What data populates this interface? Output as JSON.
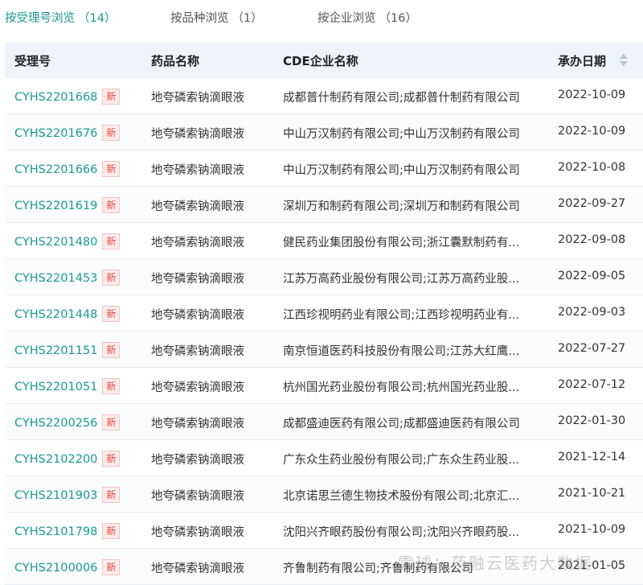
{
  "tabs": [
    {
      "label": "按受理号浏览",
      "count": "（14）",
      "active": true
    },
    {
      "label": "按品种浏览",
      "count": "（1）",
      "active": false
    },
    {
      "label": "按企业浏览",
      "count": "（16）",
      "active": false
    }
  ],
  "table": {
    "headers": {
      "id": "受理号",
      "drug": "药品名称",
      "company": "CDE企业名称",
      "date": "承办日期"
    },
    "badge_label": "新",
    "rows": [
      {
        "id": "CYHS2201668",
        "drug": "地夸磷索钠滴眼液",
        "company": "成都普什制药有限公司;成都普什制药有限公司",
        "date": "2022-10-09"
      },
      {
        "id": "CYHS2201676",
        "drug": "地夸磷索钠滴眼液",
        "company": "中山万汉制药有限公司;中山万汉制药有限公司",
        "date": "2022-10-09"
      },
      {
        "id": "CYHS2201666",
        "drug": "地夸磷索钠滴眼液",
        "company": "中山万汉制药有限公司;中山万汉制药有限公司",
        "date": "2022-10-08"
      },
      {
        "id": "CYHS2201619",
        "drug": "地夸磷索钠滴眼液",
        "company": "深圳万和制药有限公司;深圳万和制药有限公司",
        "date": "2022-09-27"
      },
      {
        "id": "CYHS2201480",
        "drug": "地夸磷索钠滴眼液",
        "company": "健民药业集团股份有限公司;浙江囊默制药有...",
        "date": "2022-09-08"
      },
      {
        "id": "CYHS2201453",
        "drug": "地夸磷索钠滴眼液",
        "company": "江苏万高药业股份有限公司;江苏万高药业股...",
        "date": "2022-09-05"
      },
      {
        "id": "CYHS2201448",
        "drug": "地夸磷索钠滴眼液",
        "company": "江西珍视明药业有限公司;江西珍视明药业有...",
        "date": "2022-09-03"
      },
      {
        "id": "CYHS2201151",
        "drug": "地夸磷索钠滴眼液",
        "company": "南京恒道医药科技股份有限公司;江苏大红鹰...",
        "date": "2022-07-27"
      },
      {
        "id": "CYHS2201051",
        "drug": "地夸磷索钠滴眼液",
        "company": "杭州国光药业股份有限公司;杭州国光药业股...",
        "date": "2022-07-12"
      },
      {
        "id": "CYHS2200256",
        "drug": "地夸磷索钠滴眼液",
        "company": "成都盛迪医药有限公司;成都盛迪医药有限公司",
        "date": "2022-01-30"
      },
      {
        "id": "CYHS2102200",
        "drug": "地夸磷索钠滴眼液",
        "company": "广东众生药业股份有限公司;广东众生药业股...",
        "date": "2021-12-14"
      },
      {
        "id": "CYHS2101903",
        "drug": "地夸磷索钠滴眼液",
        "company": "北京诺思兰德生物技术股份有限公司;北京汇...",
        "date": "2021-10-21"
      },
      {
        "id": "CYHS2101798",
        "drug": "地夸磷索钠滴眼液",
        "company": "沈阳兴齐眼药股份有限公司;沈阳兴齐眼药股...",
        "date": "2021-10-09"
      },
      {
        "id": "CYHS2100006",
        "drug": "地夸磷索钠滴眼液",
        "company": "齐鲁制药有限公司;齐鲁制药有限公司",
        "date": "2021-01-05"
      }
    ]
  },
  "watermark": "雪球：药融云医药大数据"
}
